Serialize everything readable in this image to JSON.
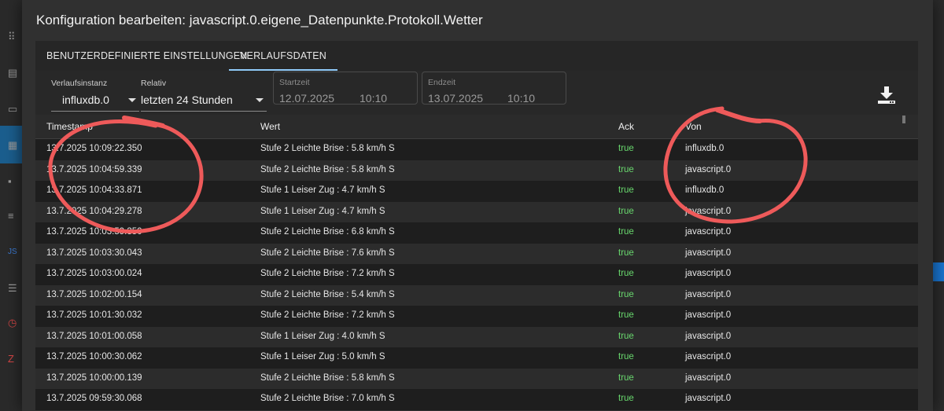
{
  "dialog": {
    "title": "Konfiguration bearbeiten: javascript.0.eigene_Datenpunkte.Protokoll.Wetter"
  },
  "tabs": [
    {
      "label": "BENUTZERDEFINIERTE EINSTELLUNGEN",
      "active": false
    },
    {
      "label": "VERLAUFSDATEN",
      "active": true
    }
  ],
  "filters": {
    "instance": {
      "label": "Verlaufsinstanz",
      "value": "influxdb.0"
    },
    "relative": {
      "label": "Relativ",
      "value": "letzten 24 Stunden"
    },
    "start": {
      "label": "Startzeit",
      "date": "12.07.2025",
      "time": "10:10"
    },
    "end": {
      "label": "Endzeit",
      "date": "13.07.2025",
      "time": "10:10"
    }
  },
  "table": {
    "headers": [
      "Timestamp",
      "Wert",
      "Ack",
      "Von"
    ],
    "rows": [
      {
        "ts": "13.7.2025 10:09:22.350",
        "val": "Stufe 2 Leichte Brise : 5.8 km/h S",
        "ack": "true",
        "from": "influxdb.0"
      },
      {
        "ts": "13.7.2025 10:04:59.339",
        "val": "Stufe 2 Leichte Brise : 5.8 km/h S",
        "ack": "true",
        "from": "javascript.0"
      },
      {
        "ts": "13.7.2025 10:04:33.871",
        "val": "Stufe 1 Leiser Zug : 4.7 km/h S",
        "ack": "true",
        "from": "influxdb.0"
      },
      {
        "ts": "13.7.2025 10:04:29.278",
        "val": "Stufe 1 Leiser Zug : 4.7 km/h S",
        "ack": "true",
        "from": "javascript.0"
      },
      {
        "ts": "13.7.2025 10:03:59.350",
        "val": "Stufe 2 Leichte Brise : 6.8 km/h S",
        "ack": "true",
        "from": "javascript.0"
      },
      {
        "ts": "13.7.2025 10:03:30.043",
        "val": "Stufe 2 Leichte Brise : 7.6 km/h S",
        "ack": "true",
        "from": "javascript.0"
      },
      {
        "ts": "13.7.2025 10:03:00.024",
        "val": "Stufe 2 Leichte Brise : 7.2 km/h S",
        "ack": "true",
        "from": "javascript.0"
      },
      {
        "ts": "13.7.2025 10:02:00.154",
        "val": "Stufe 2 Leichte Brise : 5.4 km/h S",
        "ack": "true",
        "from": "javascript.0"
      },
      {
        "ts": "13.7.2025 10:01:30.032",
        "val": "Stufe 2 Leichte Brise : 7.2 km/h S",
        "ack": "true",
        "from": "javascript.0"
      },
      {
        "ts": "13.7.2025 10:01:00.058",
        "val": "Stufe 1 Leiser Zug : 4.0 km/h S",
        "ack": "true",
        "from": "javascript.0"
      },
      {
        "ts": "13.7.2025 10:00:30.062",
        "val": "Stufe 1 Leiser Zug : 5.0 km/h S",
        "ack": "true",
        "from": "javascript.0"
      },
      {
        "ts": "13.7.2025 10:00:00.139",
        "val": "Stufe 2 Leichte Brise : 5.8 km/h S",
        "ack": "true",
        "from": "javascript.0"
      },
      {
        "ts": "13.7.2025 09:59:30.068",
        "val": "Stufe 2 Leichte Brise : 7.0 km/h S",
        "ack": "true",
        "from": "javascript.0"
      }
    ]
  },
  "colors": {
    "ack_true": "#69d96e",
    "tab_indicator": "#90caf9",
    "annotation": "#ee5a5a"
  }
}
